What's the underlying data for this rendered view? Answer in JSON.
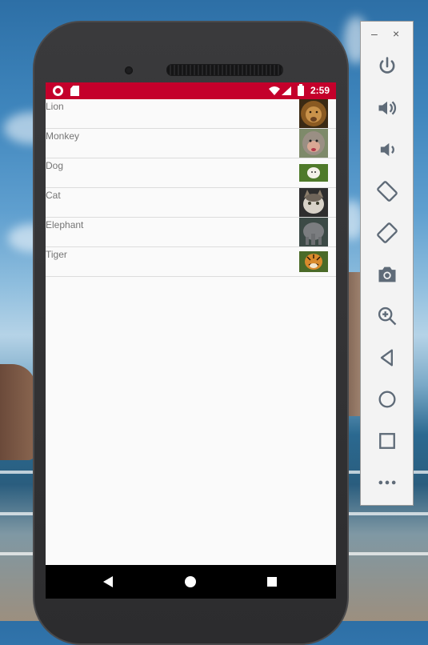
{
  "statusbar": {
    "time": "2:59",
    "color": "#c4002b"
  },
  "animals": [
    {
      "name": "Lion",
      "icon": "lion-thumbnail"
    },
    {
      "name": "Monkey",
      "icon": "monkey-thumbnail"
    },
    {
      "name": "Dog",
      "icon": "dog-thumbnail"
    },
    {
      "name": "Cat",
      "icon": "cat-thumbnail"
    },
    {
      "name": "Elephant",
      "icon": "elephant-thumbnail"
    },
    {
      "name": "Tiger",
      "icon": "tiger-thumbnail"
    }
  ],
  "emulator_panel": {
    "minimize_label": "–",
    "close_label": "×",
    "buttons": [
      "power-icon",
      "volume-up-icon",
      "volume-down-icon",
      "rotate-left-icon",
      "rotate-right-icon",
      "camera-icon",
      "zoom-icon",
      "back-icon",
      "home-icon",
      "overview-icon",
      "more-icon"
    ]
  }
}
